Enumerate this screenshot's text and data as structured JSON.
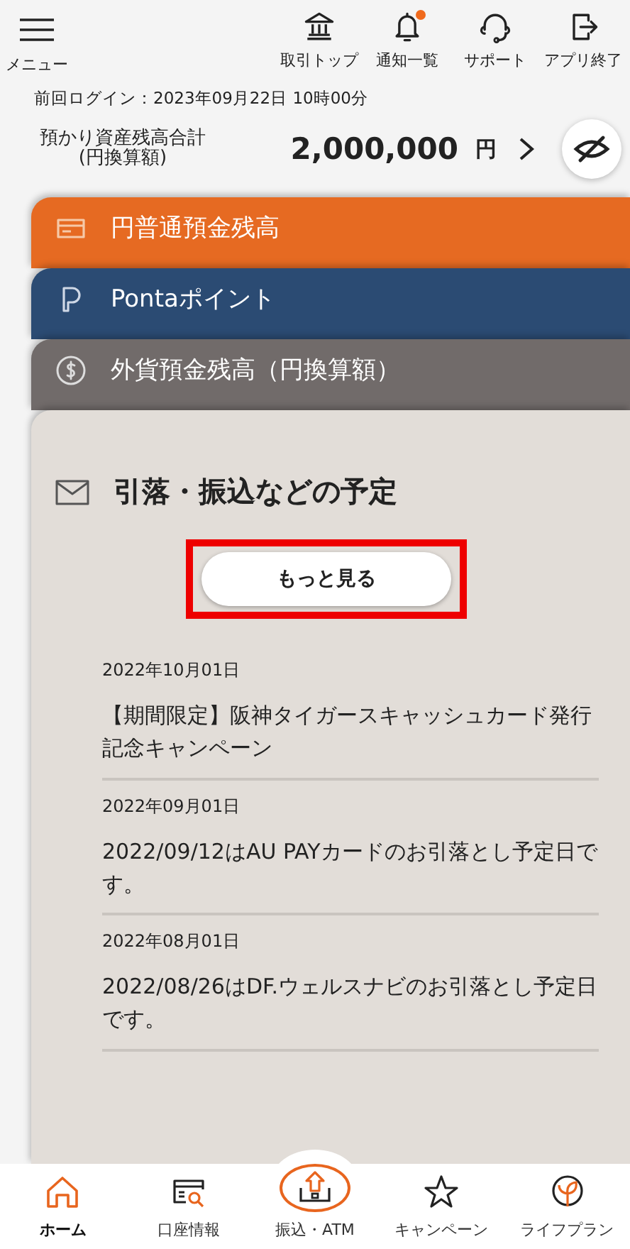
{
  "header": {
    "menu_label": "メニュー",
    "actions": [
      {
        "kind": "bank",
        "label": "取引トップ",
        "unread": false
      },
      {
        "kind": "bell",
        "label": "通知一覧",
        "unread": true
      },
      {
        "kind": "support",
        "label": "サポート",
        "unread": false
      },
      {
        "kind": "exit",
        "label": "アプリ終了",
        "unread": false
      }
    ]
  },
  "last_login": "前回ログイン：2023年09月22日 10時00分",
  "total": {
    "label_line1": "預かり資産残高合計",
    "label_line2": "(円換算額)",
    "amount": "2,000,000",
    "unit": "円"
  },
  "cards": [
    {
      "kind": "yen",
      "title": "円普通預金残高",
      "color": "#e66a22"
    },
    {
      "kind": "ponta",
      "title": "Pontaポイント",
      "color": "#2b4b73"
    },
    {
      "kind": "foreign",
      "title": "外貨預金残高（円換算額）",
      "color": "#716b6a"
    }
  ],
  "schedule": {
    "title": "引落・振込などの予定",
    "more_button": "もっと見る",
    "highlighted": true,
    "items": [
      {
        "date": "2022年10月01日",
        "text": "【期間限定】阪神タイガースキャッシュカード発行記念キャンペーン"
      },
      {
        "date": "2022年09月01日",
        "text": "2022/09/12はAU PAYカードのお引落とし予定日です。"
      },
      {
        "date": "2022年08月01日",
        "text": "2022/08/26はDF.ウェルスナビのお引落とし予定日です。"
      }
    ]
  },
  "bottom_nav": [
    {
      "kind": "home",
      "label": "ホーム",
      "selected": true
    },
    {
      "kind": "account",
      "label": "口座情報",
      "selected": false
    },
    {
      "kind": "atm",
      "label": "振込・ATM",
      "selected": false
    },
    {
      "kind": "campaign",
      "label": "キャンペーン",
      "selected": false
    },
    {
      "kind": "lifeplan",
      "label": "ライフプラン",
      "selected": false
    }
  ]
}
